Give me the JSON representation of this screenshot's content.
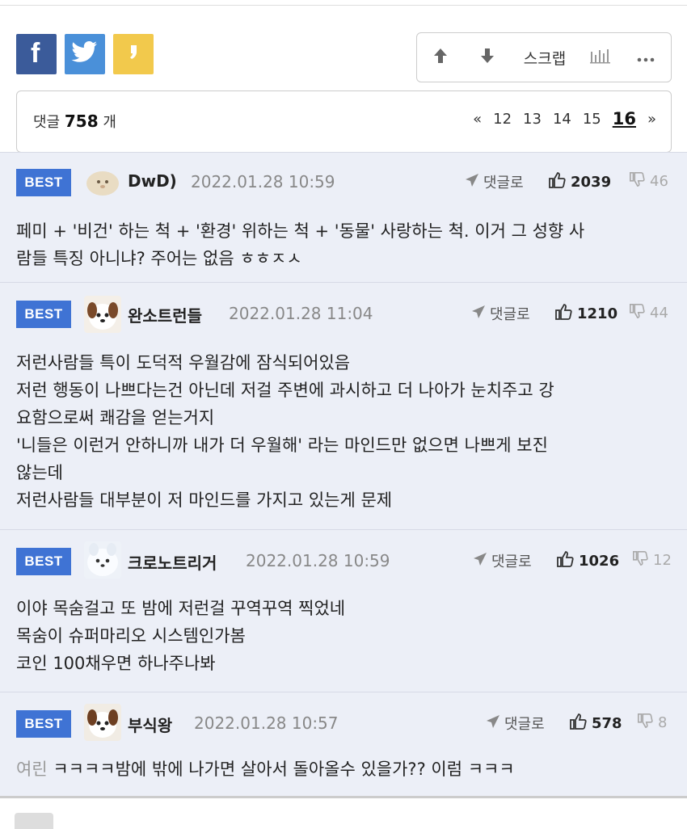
{
  "share": {
    "facebook_icon": "facebook-icon",
    "twitter_icon": "twitter-icon",
    "kakao_icon": "kakaostory-icon"
  },
  "actions": {
    "upvote_icon": "arrow-up-icon",
    "downvote_icon": "arrow-down-icon",
    "scrap_label": "스크랩",
    "stats_icon": "bar-chart-icon",
    "more_icon": "more-icon"
  },
  "comment_count": {
    "prefix": "댓글",
    "count": "758",
    "suffix": "개"
  },
  "pagination": {
    "prev": "«",
    "pages": [
      "12",
      "13",
      "14",
      "15",
      "16"
    ],
    "current": "16",
    "next": "»"
  },
  "colors": {
    "best_badge": "#3f73d4",
    "comment_bg": "#eceff7",
    "facebook": "#3b5b9a",
    "twitter": "#4a90d9",
    "kakao": "#f2c94c"
  },
  "comments": [
    {
      "badge": "BEST",
      "nickname": "DwD)",
      "date": "2022.01.28 10:59",
      "reply_label": "댓글로",
      "likes": "2039",
      "dislikes": "46",
      "lines": [
        "페미 + '비건' 하는 척 + '환경' 위하는 척 + '동물' 사랑하는 척. 이거 그 성향 사",
        "람들 특징 아니냐? 주어는 없음 ㅎㅎㅈㅅ"
      ]
    },
    {
      "badge": "BEST",
      "nickname": "완소트런들",
      "date": "2022.01.28 11:04",
      "reply_label": "댓글로",
      "likes": "1210",
      "dislikes": "44",
      "lines": [
        "저런사람들 특이 도덕적 우월감에 잠식되어있음",
        "저런 행동이 나쁘다는건 아닌데 저걸 주변에 과시하고 더 나아가 눈치주고 강",
        "요함으로써 쾌감을 얻는거지",
        "'니들은 이런거 안하니까 내가 더 우월해' 라는 마인드만 없으면 나쁘게 보진",
        "않는데",
        "저런사람들 대부분이 저 마인드를 가지고 있는게 문제"
      ]
    },
    {
      "badge": "BEST",
      "nickname": "크로노트리거",
      "date": "2022.01.28 10:59",
      "reply_label": "댓글로",
      "likes": "1026",
      "dislikes": "12",
      "lines": [
        "이야 목숨걸고 또 밤에 저런걸 꾸역꾸역 찍었네",
        "목숨이 슈퍼마리오 시스템인가봄",
        "코인 100채우면 하나주나봐"
      ]
    },
    {
      "badge": "BEST",
      "nickname": "부식왕",
      "date": "2022.01.28 10:57",
      "reply_label": "댓글로",
      "likes": "578",
      "dislikes": "8",
      "prefix": "여린",
      "lines": [
        "ㅋㅋㅋㅋ밤에 밖에 나가면 살아서 돌아올수 있을가?? 이럼 ㅋㅋㅋ"
      ]
    }
  ]
}
